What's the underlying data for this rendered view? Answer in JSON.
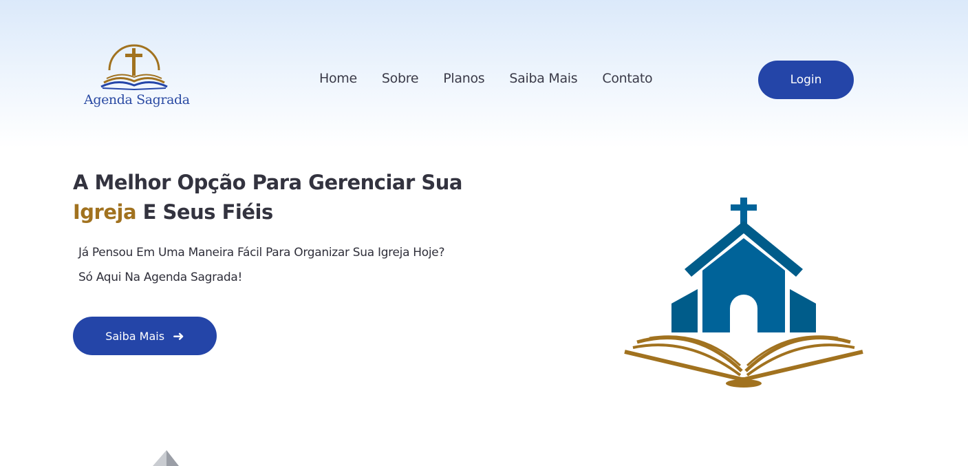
{
  "brand": {
    "name": "Agenda Sagrada"
  },
  "nav": {
    "items": [
      "Home",
      "Sobre",
      "Planos",
      "Saiba Mais",
      "Contato"
    ]
  },
  "header": {
    "login_label": "Login"
  },
  "hero": {
    "title_part1": "A Melhor Opção Para Gerenciar Sua",
    "title_accent": "Igreja",
    "title_part2": " E Seus Fiéis",
    "subtitle_line1": "Já Pensou Em Uma Maneira Fácil Para Organizar Sua Igreja Hoje?",
    "subtitle_line2": "Só Aqui Na Agenda Sagrada!",
    "cta_label": "Saiba Mais",
    "cta_icon": "arrow-right-icon",
    "illustration_icon": "church-with-open-book-icon"
  },
  "colors": {
    "primary": "#2445a8",
    "accent": "#a1721f",
    "church_blue": "#006399",
    "church_dark": "#005c8a",
    "text": "#33333f"
  }
}
